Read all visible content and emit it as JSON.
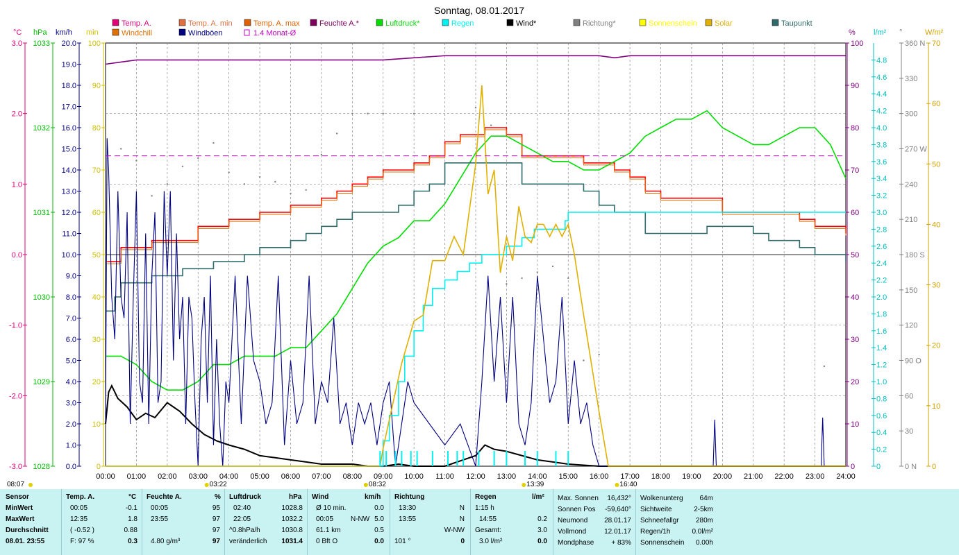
{
  "title": "Sonntag, 08.01.2017",
  "colors": {
    "temp": "#ff0000",
    "temp_min": "#ff0000",
    "temp_max": "#e07000",
    "windchill": "#f08000",
    "windboeen": "#000080",
    "feuchte": "#800080",
    "luftdruck": "#00dd00",
    "regen": "#00f0f0",
    "wind": "#000000",
    "richtung": "#808080",
    "solar": "#e0b000",
    "taupunkt": "#2f6b6b",
    "monat": "#c000c0",
    "stats_bg": "#c9f3f3"
  },
  "legend": [
    {
      "label": "Temp. A.",
      "color": "#e0007a"
    },
    {
      "label": "Temp. A. min",
      "color": "#e07040"
    },
    {
      "label": "Temp. A. max",
      "color": "#e06000"
    },
    {
      "label": "Feuchte A.*",
      "color": "#800060"
    },
    {
      "label": "Luftdruck*",
      "color": "#00dd00"
    },
    {
      "label": "Regen",
      "color": "#00f0f0"
    },
    {
      "label": "Wind*",
      "color": "#000000"
    },
    {
      "label": "Richtung*",
      "color": "#808080"
    },
    {
      "label": "Sonnenschein",
      "color": "#ffff00"
    },
    {
      "label": "Solar",
      "color": "#e0b000"
    },
    {
      "label": "Taupunkt",
      "color": "#2f6b6b"
    },
    {
      "label": "Windchill",
      "color": "#e07000"
    },
    {
      "label": "Windböen",
      "color": "#000080"
    },
    {
      "label": "1.4 Monat-Ø",
      "color": "#c000c0"
    }
  ],
  "axis_units": {
    "temp": "°C",
    "press": "hPa",
    "wind": "km/h",
    "min": "min",
    "pct": "%",
    "rain": "l/m²",
    "dir": "°",
    "solar": "W/m²"
  },
  "axes": {
    "temp_ticks": [
      "3.0",
      "2.0",
      "1.0",
      "0.0",
      "-1.0",
      "-2.0",
      "-3.0"
    ],
    "press_ticks": [
      "1033",
      "1032",
      "1031",
      "1030",
      "1029",
      "1028"
    ],
    "wind_ticks": [
      "20.0",
      "19.0",
      "18.0",
      "17.0",
      "16.0",
      "15.0",
      "14.0",
      "13.0",
      "12.0",
      "11.0",
      "10.0",
      "9.0",
      "8.0",
      "7.0",
      "6.0",
      "5.0",
      "4.0",
      "3.0",
      "2.0",
      "1.0",
      "0.0"
    ],
    "min_ticks": [
      "100",
      "90",
      "80",
      "70",
      "60",
      "50",
      "40",
      "30",
      "20",
      "10",
      "0"
    ],
    "pct_ticks": [
      "100",
      "90",
      "80",
      "70",
      "60",
      "50",
      "40",
      "30",
      "20",
      "10",
      "0"
    ],
    "rain_ticks": [
      "4.8",
      "4.6",
      "4.4",
      "4.2",
      "4.0",
      "3.8",
      "3.6",
      "3.4",
      "3.2",
      "3.0",
      "2.8",
      "2.6",
      "2.4",
      "2.2",
      "2.0",
      "1.8",
      "1.6",
      "1.4",
      "1.2",
      "1.0",
      "0.8",
      "0.6",
      "0.4",
      "0.2",
      "0"
    ],
    "dir_ticks": [
      "360 N",
      "330",
      "300",
      "270 W",
      "240",
      "210",
      "180 S",
      "150",
      "120",
      "90 O",
      "60",
      "30",
      "0 N"
    ],
    "solar_ticks": [
      "70",
      "60",
      "50",
      "40",
      "30",
      "20",
      "10",
      "0"
    ],
    "x_ticks": [
      "00:00",
      "01:00",
      "02:00",
      "03:00",
      "04:00",
      "05:00",
      "06:00",
      "07:00",
      "08:00",
      "09:00",
      "10:00",
      "11:00",
      "12:00",
      "13:00",
      "14:00",
      "15:00",
      "16:00",
      "17:00",
      "18:00",
      "19:00",
      "20:00",
      "21:00",
      "22:00",
      "23:00",
      "24:00"
    ],
    "sun_marks": [
      "08:07",
      "03:22",
      "08:32",
      "13:39",
      "16:40"
    ]
  },
  "chart_data": {
    "type": "line",
    "xlabel": "",
    "xlim": [
      0,
      24
    ],
    "series": [
      {
        "name": "Temp. A.",
        "unit": "°C",
        "x": [
          0.05,
          0.5,
          1,
          1.5,
          2,
          2.5,
          3,
          3.5,
          4,
          4.5,
          5,
          5.5,
          6,
          6.5,
          7,
          7.5,
          8,
          8.5,
          9,
          9.5,
          10,
          10.5,
          11,
          11.5,
          12,
          12.3,
          12.6,
          13,
          13.5,
          14,
          14.5,
          15,
          15.5,
          16,
          16.5,
          17,
          17.5,
          18,
          18.5,
          19,
          19.5,
          20,
          20.5,
          21,
          21.5,
          22,
          22.5,
          23,
          23.5,
          24
        ],
        "y": [
          -0.1,
          0.1,
          0.1,
          0.2,
          0.2,
          0.2,
          0.4,
          0.4,
          0.5,
          0.5,
          0.6,
          0.6,
          0.7,
          0.7,
          0.8,
          0.9,
          1.0,
          1.1,
          1.2,
          1.2,
          1.3,
          1.4,
          1.6,
          1.7,
          1.7,
          1.8,
          1.8,
          1.7,
          1.4,
          1.4,
          1.4,
          1.4,
          1.3,
          1.3,
          1.2,
          1.1,
          0.9,
          0.8,
          0.8,
          0.8,
          0.8,
          0.6,
          0.6,
          0.6,
          0.6,
          0.6,
          0.5,
          0.4,
          0.4,
          0.3
        ]
      },
      {
        "name": "Feuchte A.*",
        "unit": "%",
        "x": [
          0,
          0.5,
          1,
          2,
          4,
          6,
          8,
          9,
          10,
          11,
          12,
          13,
          14,
          15,
          16,
          16.5,
          17,
          18,
          20,
          22,
          24
        ],
        "y": [
          95,
          95.5,
          96,
          96,
          96,
          96,
          96,
          96,
          96.5,
          97,
          97,
          97,
          97,
          97,
          97,
          96.5,
          97,
          97,
          97,
          97,
          97
        ]
      },
      {
        "name": "Luftdruck*",
        "unit": "hPa",
        "x": [
          0,
          0.5,
          1,
          1.5,
          2,
          2.5,
          3,
          3.5,
          4,
          4.5,
          5,
          5.5,
          6,
          6.5,
          7,
          7.5,
          8,
          8.5,
          9,
          9.5,
          10,
          10.5,
          11,
          11.5,
          12,
          12.5,
          13,
          13.5,
          14,
          14.5,
          15,
          15.5,
          16,
          16.5,
          17,
          17.5,
          18,
          18.5,
          19,
          19.5,
          20,
          20.5,
          21,
          21.5,
          22,
          22.5,
          23,
          23.5,
          24
        ],
        "y": [
          1029.3,
          1029.3,
          1029.2,
          1029.0,
          1028.9,
          1028.9,
          1029.0,
          1029.2,
          1029.2,
          1029.3,
          1029.3,
          1029.3,
          1029.4,
          1029.4,
          1029.6,
          1029.8,
          1030.1,
          1030.4,
          1030.6,
          1030.7,
          1030.9,
          1030.9,
          1031.1,
          1031.4,
          1031.7,
          1031.9,
          1031.9,
          1031.8,
          1031.7,
          1031.6,
          1031.6,
          1031.5,
          1031.5,
          1031.6,
          1031.7,
          1031.9,
          1032.0,
          1032.1,
          1032.1,
          1032.2,
          1032.0,
          1031.9,
          1031.8,
          1031.8,
          1031.9,
          1032.0,
          1032.0,
          1031.8,
          1031.4
        ]
      },
      {
        "name": "Taupunkt",
        "unit": "°C",
        "x": [
          0,
          0.3,
          0.5,
          1,
          1.5,
          2,
          2.5,
          3,
          3.5,
          4,
          4.5,
          5,
          5.5,
          6,
          6.5,
          7,
          7.5,
          8,
          8.5,
          9,
          9.5,
          10,
          10.5,
          11,
          11.5,
          12,
          12.5,
          13,
          13.5,
          14,
          14.5,
          15,
          15.5,
          16,
          16.5,
          17,
          17.5,
          18,
          18.5,
          19,
          19.5,
          20,
          20.5,
          21,
          21.5,
          22,
          22.5,
          23,
          23.5,
          24
        ],
        "y": [
          -0.8,
          -0.6,
          -0.4,
          -0.4,
          -0.3,
          -0.3,
          -0.2,
          -0.2,
          -0.1,
          -0.1,
          0.0,
          0.1,
          0.1,
          0.2,
          0.3,
          0.4,
          0.5,
          0.6,
          0.6,
          0.6,
          0.7,
          0.9,
          1.0,
          1.3,
          1.3,
          1.3,
          1.3,
          1.3,
          1.0,
          1.0,
          1.0,
          1.0,
          0.9,
          0.7,
          0.6,
          0.6,
          0.3,
          0.3,
          0.3,
          0.3,
          0.4,
          0.4,
          0.4,
          0.3,
          0.2,
          0.2,
          0.1,
          0.0,
          0.0,
          -0.1
        ]
      },
      {
        "name": "Wind*",
        "unit": "km/h",
        "x": [
          0,
          0.1,
          0.2,
          0.4,
          0.7,
          1,
          1.3,
          1.6,
          2,
          2.4,
          2.8,
          3.2,
          3.6,
          4,
          4.5,
          5,
          5.5,
          6,
          6.5,
          7,
          7.5,
          8,
          8.5,
          9,
          9.5,
          10,
          11,
          12,
          12.3,
          12.6,
          13,
          13.5,
          14,
          14.5,
          15,
          16,
          17,
          18,
          19,
          20,
          21,
          22,
          23,
          24
        ],
        "y": [
          2.0,
          3.5,
          3.8,
          3.2,
          2.8,
          2.2,
          2.5,
          2.3,
          3.0,
          2.6,
          2.0,
          1.5,
          1.2,
          1.0,
          0.8,
          0.5,
          0.4,
          0.3,
          0.2,
          0.1,
          0.1,
          0.1,
          0.0,
          0.0,
          0.1,
          0.0,
          0.0,
          0.5,
          1.0,
          0.8,
          0.7,
          0.5,
          0.3,
          0.2,
          0.1,
          0.0,
          0.0,
          0.0,
          0.0,
          0.0,
          0.0,
          0.0,
          0.0,
          0.0
        ]
      },
      {
        "name": "Windböen",
        "unit": "km/h",
        "x": [
          0,
          0.05,
          0.1,
          0.2,
          0.3,
          0.4,
          0.5,
          0.6,
          0.7,
          0.8,
          0.9,
          1.0,
          1.1,
          1.2,
          1.3,
          1.4,
          1.5,
          1.6,
          1.7,
          1.8,
          1.9,
          2.0,
          2.1,
          2.2,
          2.3,
          2.4,
          2.5,
          2.6,
          2.7,
          2.8,
          2.9,
          3.0,
          3.1,
          3.2,
          3.3,
          3.4,
          3.5,
          3.6,
          3.7,
          3.8,
          3.9,
          4.0,
          4.2,
          4.4,
          4.6,
          4.8,
          5.0,
          5.2,
          5.4,
          5.6,
          5.8,
          6.0,
          6.2,
          6.4,
          6.6,
          6.8,
          7.0,
          7.2,
          7.4,
          7.6,
          7.8,
          8.0,
          8.2,
          8.4,
          8.6,
          8.8,
          9.0,
          9.2,
          9.4,
          9.6,
          9.8,
          10.0,
          10.5,
          11,
          11.5,
          12,
          12.2,
          12.4,
          12.6,
          12.8,
          13.0,
          13.2,
          13.4,
          13.6,
          13.8,
          14.0,
          14.2,
          14.4,
          14.6,
          14.8,
          15.0,
          15.2,
          15.4,
          15.6,
          15.8,
          16,
          16.5,
          17,
          18,
          19,
          19.7,
          19.75,
          19.8,
          20,
          21,
          22,
          23,
          23.2,
          23.25,
          23.3,
          24
        ],
        "y": [
          2,
          15.5,
          14,
          8,
          6,
          13,
          8,
          7,
          12,
          2,
          8,
          13,
          4,
          3,
          11,
          2,
          9,
          12,
          3,
          4,
          13,
          9,
          13,
          5,
          11,
          6,
          8,
          2,
          8,
          7,
          3,
          0,
          6,
          8,
          3,
          9,
          1,
          6,
          2,
          0,
          4,
          3,
          9,
          2,
          9,
          5,
          4,
          2,
          3,
          9,
          1,
          5,
          2,
          3,
          9,
          2,
          4,
          3,
          7,
          2,
          3,
          1,
          3,
          2,
          3,
          1,
          3,
          4,
          0,
          2,
          4,
          3,
          2,
          1,
          2,
          0,
          4,
          9,
          4,
          8,
          3,
          8,
          2,
          1,
          3,
          9,
          6,
          3,
          4,
          8,
          2,
          5,
          2,
          3,
          1,
          0,
          0,
          0,
          0,
          0,
          0,
          2.2,
          0,
          0,
          0,
          0,
          0,
          0,
          2.3,
          0,
          0
        ]
      },
      {
        "name": "Regen",
        "unit": "l/m²",
        "x": [
          0,
          8.9,
          9.0,
          9.2,
          9.2,
          9.5,
          9.5,
          9.7,
          9.7,
          10.0,
          10.0,
          10.3,
          10.3,
          10.6,
          10.6,
          11.0,
          11.0,
          11.4,
          11.4,
          11.8,
          11.8,
          12.2,
          12.2,
          12.6,
          12.6,
          13.0,
          13.0,
          13.5,
          13.5,
          13.9,
          13.9,
          14.6,
          14.6,
          14.9,
          14.9,
          15.0,
          15.0,
          16.3,
          16.3,
          24
        ],
        "y": [
          0,
          0,
          0.3,
          0.6,
          0.6,
          0.9,
          1.0,
          1.2,
          1.3,
          1.5,
          1.6,
          1.8,
          1.9,
          2.1,
          2.1,
          2.2,
          2.2,
          2.3,
          2.3,
          2.3,
          2.4,
          2.5,
          2.5,
          2.5,
          2.5,
          2.6,
          2.6,
          2.7,
          2.7,
          2.8,
          2.8,
          2.8,
          2.8,
          2.9,
          2.9,
          3.0,
          3.0,
          3.0,
          3.0,
          3.0
        ]
      },
      {
        "name": "Solar",
        "unit": "W/m²",
        "x": [
          0,
          8.9,
          9.0,
          9.3,
          9.6,
          10,
          10.3,
          10.6,
          11,
          11.3,
          11.6,
          12,
          12.2,
          12.4,
          12.6,
          12.8,
          13,
          13.2,
          13.4,
          13.6,
          13.8,
          14,
          14.2,
          14.4,
          14.6,
          14.8,
          15,
          15.2,
          15.5,
          16,
          16.3,
          16.4,
          24
        ],
        "y": [
          0,
          0,
          3,
          10,
          17,
          24,
          25,
          34,
          34,
          38,
          35,
          50,
          63,
          45,
          49,
          32,
          38,
          34,
          43,
          38,
          37,
          40,
          40,
          38,
          40,
          38,
          40,
          35,
          25,
          9,
          0,
          0,
          0
        ]
      },
      {
        "name": "Richtung*",
        "unit": "°",
        "x": [
          0,
          0.5,
          1,
          1.5,
          2,
          2.5,
          3,
          3.5,
          4,
          4.5,
          5,
          5.5,
          6,
          6.5,
          7,
          7.5,
          8,
          8.5,
          9,
          10,
          12,
          12.5,
          13,
          13.5,
          14,
          14.5,
          15,
          15.5,
          16,
          23.3
        ],
        "y": [
          300,
          270,
          260,
          230,
          240,
          255,
          262,
          275,
          250,
          240,
          246,
          242,
          232,
          235,
          265,
          283,
          300,
          300,
          300,
          300,
          305,
          290,
          155,
          160,
          165,
          170,
          160,
          90,
          95,
          85
        ]
      },
      {
        "name": "1.4 Monat-Ø",
        "unit": "°C",
        "x": [
          0,
          24
        ],
        "y": [
          1.4,
          1.4
        ]
      }
    ]
  },
  "stats": {
    "headers": {
      "sensor": "Sensor",
      "temp": "Temp. A.",
      "temp_u": "°C",
      "feuchte": "Feuchte A.",
      "feuchte_u": "%",
      "luft": "Luftdruck",
      "luft_u": "hPa",
      "wind": "Wind",
      "wind_u": "km/h",
      "richtung": "Richtung",
      "regen": "Regen",
      "regen_u": "l/m²"
    },
    "rows": {
      "min": "MinWert",
      "max": "MaxWert",
      "avg": "Durchschnitt",
      "date": "08.01. 23:55"
    },
    "temp": {
      "min_t": "00:05",
      "min_v": "-0.1",
      "max_t": "12:35",
      "max_v": "1.8",
      "avg_a": "( -0.52 )",
      "avg_v": "0.88",
      "last_a": "F: 97 %",
      "last_v": "0.3"
    },
    "feuchte": {
      "min_t": "00:05",
      "min_v": "95",
      "max_t": "23:55",
      "max_v": "97",
      "avg_v": "97",
      "last_a": "4.80 g/m³",
      "last_v": "97"
    },
    "luft": {
      "min_t": "02:40",
      "min_v": "1028.8",
      "max_t": "22:05",
      "max_v": "1032.2",
      "avg_a": "^0.8hPa/h",
      "avg_v": "1030.8",
      "last_a": "veränderlich",
      "last_v": "1031.4"
    },
    "wind": {
      "r1_a": "Ø 10 min.",
      "r1_v": "0.0",
      "r2_a": "00:05",
      "r2_b": "N-NW",
      "r2_v": "5.0",
      "r3_a": "61.1 km",
      "r3_v": "0.5",
      "r4_a": "0 Bft O",
      "r4_v": "0.0"
    },
    "richtung": {
      "r1_a": "13:30",
      "r1_v": "N",
      "r2_a": "13:55",
      "r2_v": "N",
      "r3_v": "W-NW",
      "r4_a": "101 °",
      "r4_v": "0"
    },
    "regen": {
      "r1_a": "1:15 h",
      "r2_a": "14:55",
      "r2_v": "0.2",
      "r3_a": "Gesamt:",
      "r3_v": "3.0",
      "r4_a": "3.0 l/m²",
      "r4_v": "0.0"
    },
    "sun": [
      [
        "Max. Sonnen",
        "16,432°"
      ],
      [
        "Sonnen Pos",
        "-59,640°"
      ],
      [
        "Neumond",
        "28.01.17"
      ],
      [
        "Vollmond",
        "12.01.17"
      ],
      [
        "Mondphase",
        "+ 83%"
      ]
    ],
    "misc": [
      [
        "Wolkenunterg",
        "64m"
      ],
      [
        "Sichtweite",
        "2-5km"
      ],
      [
        "Schneefallgr",
        "280m"
      ],
      [
        "Regen/1h",
        "0.0l/m²"
      ],
      [
        "Sonnenschein",
        "0.00h"
      ]
    ]
  }
}
